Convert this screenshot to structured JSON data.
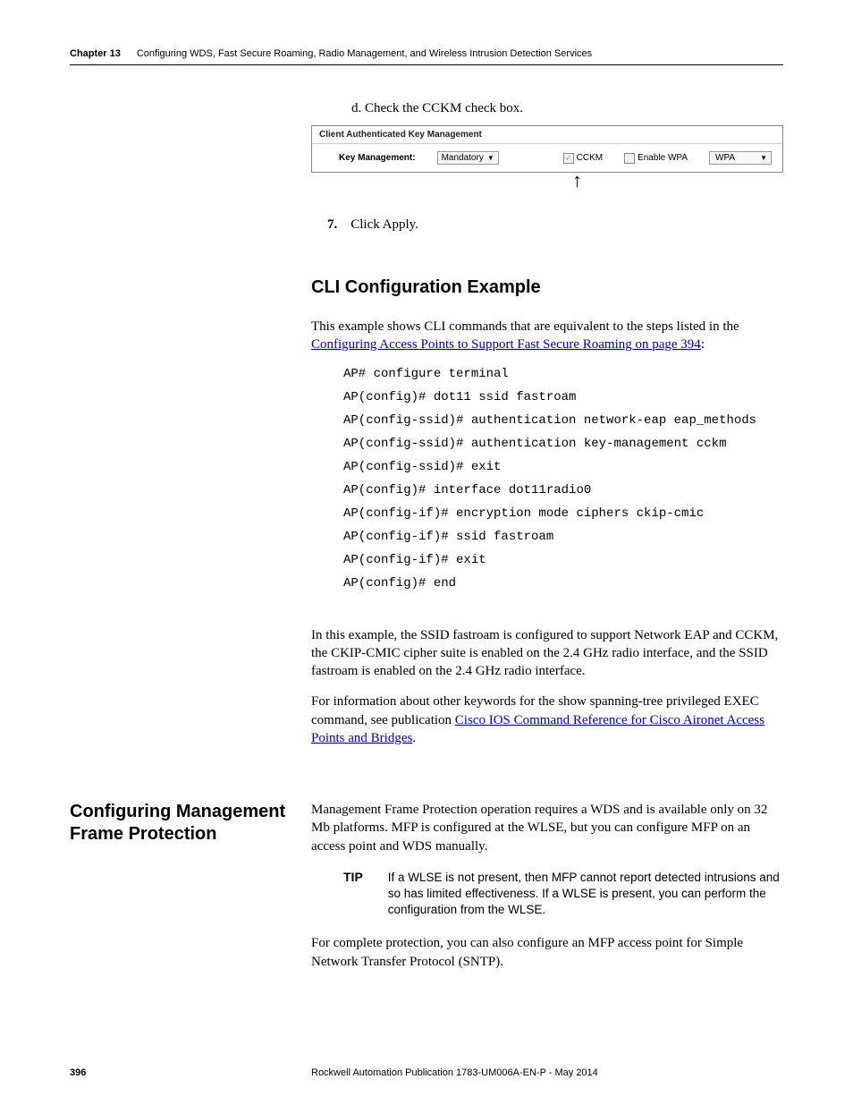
{
  "header": {
    "chapter": "Chapter 13",
    "title": "Configuring WDS, Fast Secure Roaming, Radio Management, and Wireless Intrusion Detection Services"
  },
  "step_d": "d.  Check the CCKM check box.",
  "ui": {
    "panel_title": "Client Authenticated Key Management",
    "key_mgmt_label": "Key Management:",
    "select_value": "Mandatory",
    "cckm_label": "CCKM",
    "enable_wpa_label": "Enable WPA",
    "wpa_select": "WPA"
  },
  "step7_num": "7.",
  "step7_text": "Click Apply.",
  "h2": "CLI Configuration Example",
  "intro_text": "This example shows CLI commands that are equivalent to the steps listed in the ",
  "intro_link": "Configuring Access Points to Support Fast Secure Roaming on page 394",
  "intro_colon": ":",
  "code": [
    "AP# configure terminal",
    "AP(config)# dot11 ssid fastroam",
    "AP(config-ssid)# authentication network-eap eap_methods",
    "AP(config-ssid)# authentication key-management cckm",
    "AP(config-ssid)# exit",
    "AP(config)# interface dot11radio0",
    "AP(config-if)# encryption mode ciphers ckip-cmic",
    "AP(config-if)# ssid fastroam",
    "AP(config-if)# exit",
    "AP(config)# end"
  ],
  "para_after_code": "In this example, the SSID fastroam is configured to support Network EAP and CCKM, the CKIP-CMIC cipher suite is enabled on the 2.4 GHz radio interface, and the SSID fastroam is enabled on the 2.4 GHz radio interface.",
  "para_info_pre": "For information about other keywords for the show spanning-tree privileged EXEC command, see publication ",
  "para_info_link": "Cisco IOS Command Reference for Cisco Aironet Access Points and Bridges",
  "para_info_post": ".",
  "side_heading": "Configuring Management Frame Protection",
  "mfp_para": "Management Frame Protection operation requires a WDS and is available only on 32 Mb platforms. MFP is configured at the WLSE, but you can configure MFP on an access point and WDS manually.",
  "tip_label": "TIP",
  "tip_text": "If a WLSE is not present, then MFP cannot report detected intrusions and so has limited effectiveness. If a WLSE is present, you can perform the configuration from the WLSE.",
  "mfp_para2": "For complete protection, you can also configure an MFP access point for Simple Network Transfer Protocol (SNTP).",
  "footer": {
    "page": "396",
    "pub": "Rockwell Automation Publication 1783-UM006A-EN-P - May 2014"
  }
}
